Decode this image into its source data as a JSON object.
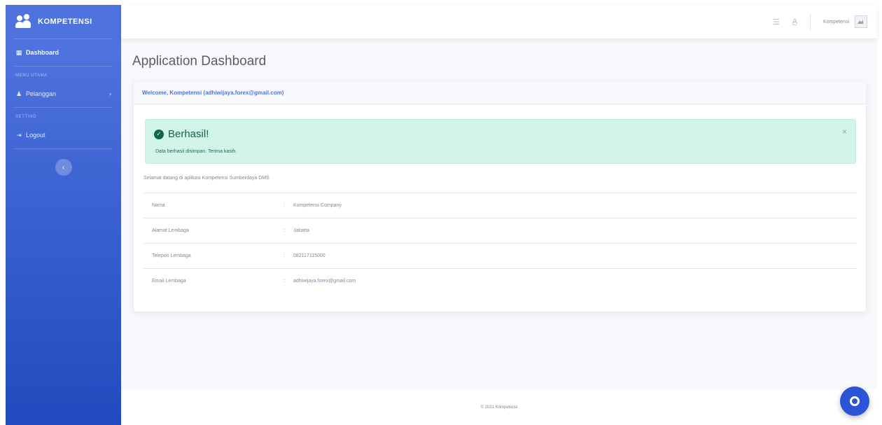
{
  "sidebar": {
    "brand": "KOMPETENSI",
    "items": [
      {
        "icon": "dashboard-icon",
        "label": "Dashboard"
      },
      {
        "icon": "user-icon",
        "label": "Pelanggan"
      },
      {
        "icon": "logout-icon",
        "label": "Logout"
      }
    ],
    "headings": [
      "Menu Utama",
      "Setting"
    ]
  },
  "topbar": {
    "user_name": "Kompetensi"
  },
  "page": {
    "title": "Application Dashboard"
  },
  "card": {
    "header": "Welcome, Kompetensi (adhiwijaya.forex@gmail.com)",
    "alert": {
      "title": "Berhasil!",
      "text": "Data berhasil disimpan. Terima kasih."
    },
    "welcome_text": "Selamat datang di aplikasi Kompetensi Sumberdaya DMS",
    "rows": [
      {
        "key": "Nama",
        "value": "Kompetensi Company"
      },
      {
        "key": "Alamat Lembaga",
        "value": "Jakarta"
      },
      {
        "key": "Telepon Lembaga",
        "value": "082117115000"
      },
      {
        "key": "Email Lembaga",
        "value": "adhiwijaya.forex@gmail.com"
      }
    ]
  },
  "footer": {
    "text": "© 2021 Kompetensi"
  },
  "colors": {
    "sidebar_top": "#4e73df",
    "sidebar_bottom": "#224abe",
    "alert_bg": "#d2f4ea",
    "alert_text": "#0f6848",
    "chat_button": "#2b54d6"
  }
}
